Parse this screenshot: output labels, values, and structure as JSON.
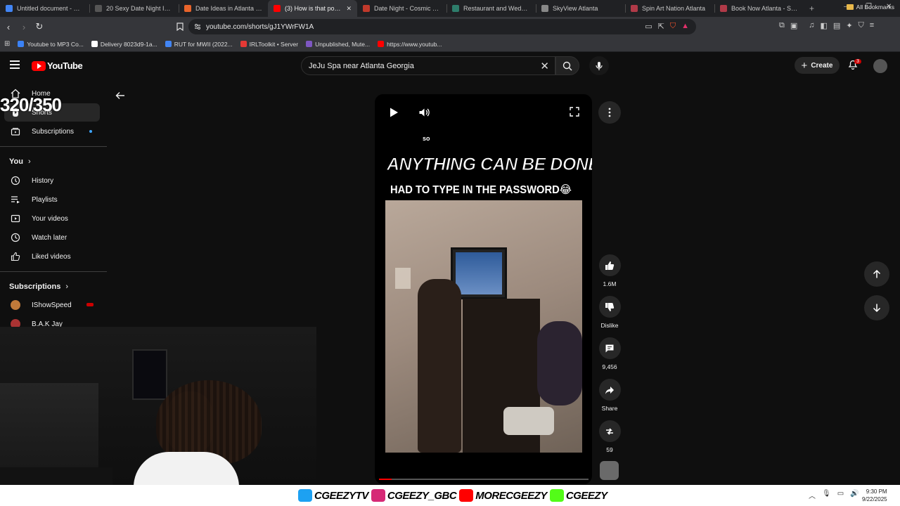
{
  "browser": {
    "tabs": [
      {
        "title": "Untitled document - Google Docs",
        "fav_color": "#4285f4"
      },
      {
        "title": "20 Sexy Date Night Ideas for Couples",
        "fav_color": "#555555"
      },
      {
        "title": "Date Ideas in Atlanta | 33 Fun Things",
        "fav_color": "#e8642b"
      },
      {
        "title": "(3) How is that possible",
        "fav_color": "#ff0000",
        "active": true
      },
      {
        "title": "Date Night - Cosmic Love",
        "fav_color": "#c0392b"
      },
      {
        "title": "Restaurant and Wedding Venue",
        "fav_color": "#2e7d6b"
      },
      {
        "title": "SkyView Atlanta",
        "fav_color": "#888888"
      },
      {
        "title": "Spin Art Nation Atlanta",
        "fav_color": "#b03a48"
      },
      {
        "title": "Book Now Atlanta - Spin Art",
        "fav_color": "#b03a48"
      }
    ],
    "url": "youtube.com/shorts/gJ1YWrFW1A",
    "bookmarks": [
      {
        "label": "Youtube to MP3 Co...",
        "fav_color": "#3b82f6"
      },
      {
        "label": "Delivery 8023d9-1a...",
        "fav_color": "#ffffff"
      },
      {
        "label": "RUT for MWII (2022...",
        "fav_color": "#4285f4"
      },
      {
        "label": "IRLToolkit • Server",
        "fav_color": "#e53935"
      },
      {
        "label": "Unpublished, Mute...",
        "fav_color": "#7e57c2"
      },
      {
        "label": "https://www.youtub...",
        "fav_color": "#ff0000"
      }
    ],
    "all_bookmarks": "All Bookmarks"
  },
  "youtube": {
    "logo_text": "YouTube",
    "search_value": "JeJu Spa near Atlanta Georgia",
    "create_label": "Create",
    "notification_count": "3"
  },
  "sidebar": {
    "items": [
      {
        "label": "Home"
      },
      {
        "label": "Shorts"
      },
      {
        "label": "Subscriptions"
      }
    ],
    "you_header": "You",
    "you_items": [
      {
        "label": "History"
      },
      {
        "label": "Playlists"
      },
      {
        "label": "Your videos"
      },
      {
        "label": "Watch later"
      },
      {
        "label": "Liked videos"
      }
    ],
    "subs_header": "Subscriptions",
    "subs": [
      {
        "label": "IShowSpeed"
      },
      {
        "label": "B.A.K Jay"
      }
    ]
  },
  "overlay_counter": "320/350",
  "short": {
    "caption_small": "so",
    "caption_main": "ANYTHING CAN BE DONE",
    "caption_sub": "HAD TO TYPE IN THE PASSWORD😂",
    "progress": 0.06
  },
  "actions": {
    "likes": "1.6M",
    "dislike": "Dislike",
    "comments": "9,456",
    "share": "Share",
    "remix": "59"
  },
  "stream": {
    "socials": [
      "CGEEZYTV",
      "CGEEZY_GBC",
      "MORECGEEZY",
      "CGEEZY"
    ],
    "social_colors": [
      "#1da1f2",
      "#d62976",
      "#ff0000",
      "#53fc18"
    ]
  },
  "clock": {
    "time": "9:30 PM",
    "date": "9/22/2025"
  }
}
